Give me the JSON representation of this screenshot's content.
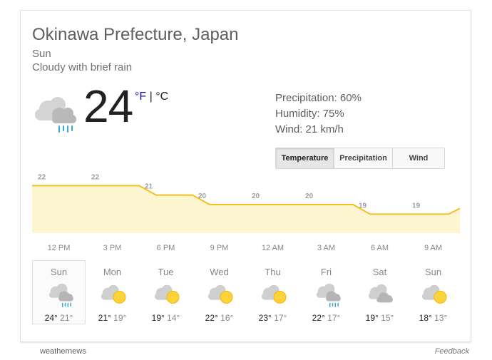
{
  "header": {
    "location": "Okinawa Prefecture, Japan",
    "day": "Sun",
    "condition": "Cloudy with brief rain"
  },
  "current": {
    "temperature": "24",
    "unit_f": "°F",
    "unit_sep": "|",
    "unit_c": "°C",
    "icon": "cloud-rain-icon",
    "precipitation": "Precipitation: 60%",
    "humidity": "Humidity: 75%",
    "wind": "Wind: 21 km/h"
  },
  "tabs": [
    {
      "label": "Temperature",
      "active": true
    },
    {
      "label": "Precipitation",
      "active": false
    },
    {
      "label": "Wind",
      "active": false
    }
  ],
  "chart_data": {
    "type": "area",
    "categories": [
      "12 PM",
      "3 PM",
      "6 PM",
      "9 PM",
      "12 AM",
      "3 AM",
      "6 AM",
      "9 AM"
    ],
    "values": [
      22,
      22,
      21,
      20,
      20,
      20,
      19,
      19
    ],
    "value_labels": [
      "22",
      "22",
      "21",
      "20",
      "20",
      "20",
      "19",
      "19"
    ],
    "ylim": [
      17,
      23
    ],
    "grid": false,
    "colors": {
      "line": "#f4c020",
      "fill": "#fdf5cf"
    }
  },
  "forecast": [
    {
      "day": "Sun",
      "hi": "24°",
      "lo": "21°",
      "icon": "cloud-rain-icon",
      "selected": true
    },
    {
      "day": "Mon",
      "hi": "21°",
      "lo": "19°",
      "icon": "partly-sunny-icon",
      "selected": false
    },
    {
      "day": "Tue",
      "hi": "19°",
      "lo": "14°",
      "icon": "partly-sunny-icon",
      "selected": false
    },
    {
      "day": "Wed",
      "hi": "22°",
      "lo": "16°",
      "icon": "partly-sunny-icon",
      "selected": false
    },
    {
      "day": "Thu",
      "hi": "23°",
      "lo": "17°",
      "icon": "partly-sunny-icon",
      "selected": false
    },
    {
      "day": "Fri",
      "hi": "22°",
      "lo": "17°",
      "icon": "cloud-rain-icon",
      "selected": false
    },
    {
      "day": "Sat",
      "hi": "19°",
      "lo": "15°",
      "icon": "cloudy-icon",
      "selected": false
    },
    {
      "day": "Sun",
      "hi": "18°",
      "lo": "13°",
      "icon": "partly-sunny-icon",
      "selected": false
    }
  ],
  "footer": {
    "source": "weathernews",
    "feedback": "Feedback"
  }
}
